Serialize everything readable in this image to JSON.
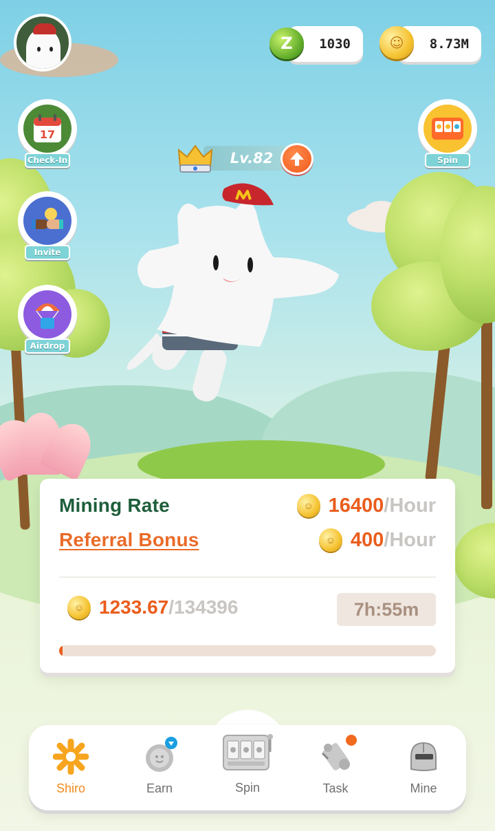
{
  "header": {
    "green_coin_amount": "1030",
    "gold_coin_amount": "8.73M",
    "green_coin_glyph": "Z"
  },
  "side_buttons": [
    {
      "label": "Check-In",
      "icon": "calendar-icon",
      "calendar_day": "17"
    },
    {
      "label": "Invite",
      "icon": "handshake-icon"
    },
    {
      "label": "Airdrop",
      "icon": "parachute-icon"
    },
    {
      "label": "Spin",
      "icon": "slot-machine-icon"
    }
  ],
  "level": {
    "text": "Lv.82",
    "upgrade_icon": "arrow-up-icon"
  },
  "card": {
    "mining_label": "Mining Rate",
    "mining_value": "16400",
    "mining_unit": "/Hour",
    "referral_label": "Referral Bonus",
    "referral_value": "400",
    "referral_unit": "/Hour",
    "balance_value": "1233.67",
    "balance_max": "/134396",
    "timer": "7h:55m",
    "progress_fraction": 0.009
  },
  "nav": {
    "items": [
      {
        "label": "Shiro",
        "icon": "asterisk-star-icon",
        "active": true
      },
      {
        "label": "Earn",
        "icon": "coin-icon",
        "badge": "diamond-badge-icon"
      },
      {
        "label": "Spin",
        "icon": "slot-machine-icon"
      },
      {
        "label": "Task",
        "icon": "scroll-icon",
        "badge": "notification-dot"
      },
      {
        "label": "Mine",
        "icon": "helmet-icon"
      }
    ]
  },
  "colors": {
    "accent_orange": "#ea5d1c",
    "mining_green": "#1e5e3b",
    "nav_active": "#f08a1c",
    "label_teal": "#7ed3d7"
  }
}
